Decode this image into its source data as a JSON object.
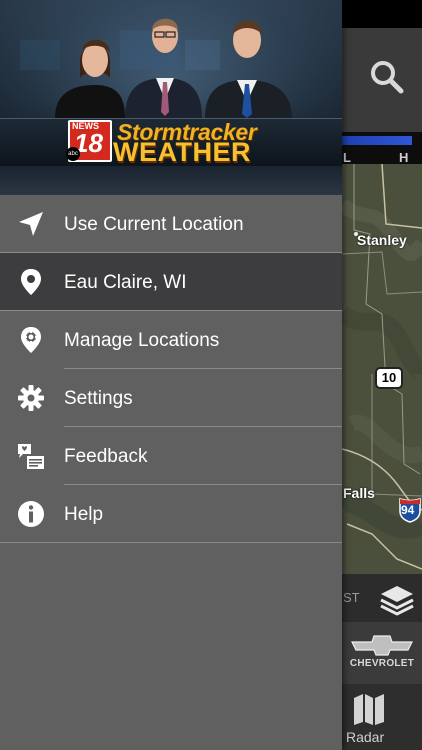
{
  "map": {
    "legend_low": "L",
    "legend_high": "H",
    "city_1": "Stanley",
    "city_2": "Falls",
    "highway_1": "10",
    "interstate_1": "94",
    "partial_text": "ST",
    "sponsor": "CHEVROLET",
    "radar_label": "Radar"
  },
  "brand": {
    "news_label": "NEWS",
    "channel_number": "18",
    "network": "abc",
    "title_line1": "Stormtracker",
    "title_line2": "WEATHER"
  },
  "menu": {
    "items": [
      {
        "label": "Use Current Location",
        "icon": "location-arrow-icon"
      },
      {
        "label": "Eau Claire, WI",
        "icon": "map-pin-icon",
        "selected": true
      },
      {
        "label": "Manage Locations",
        "icon": "manage-locations-icon"
      },
      {
        "label": "Settings",
        "icon": "gear-icon"
      },
      {
        "label": "Feedback",
        "icon": "feedback-icon"
      },
      {
        "label": "Help",
        "icon": "info-icon"
      }
    ]
  },
  "colors": {
    "drawer_bg": "#606060",
    "selected_bg": "#3d3d3f",
    "brand_gold": "#f7c030",
    "brand_red": "#d42a1e"
  }
}
